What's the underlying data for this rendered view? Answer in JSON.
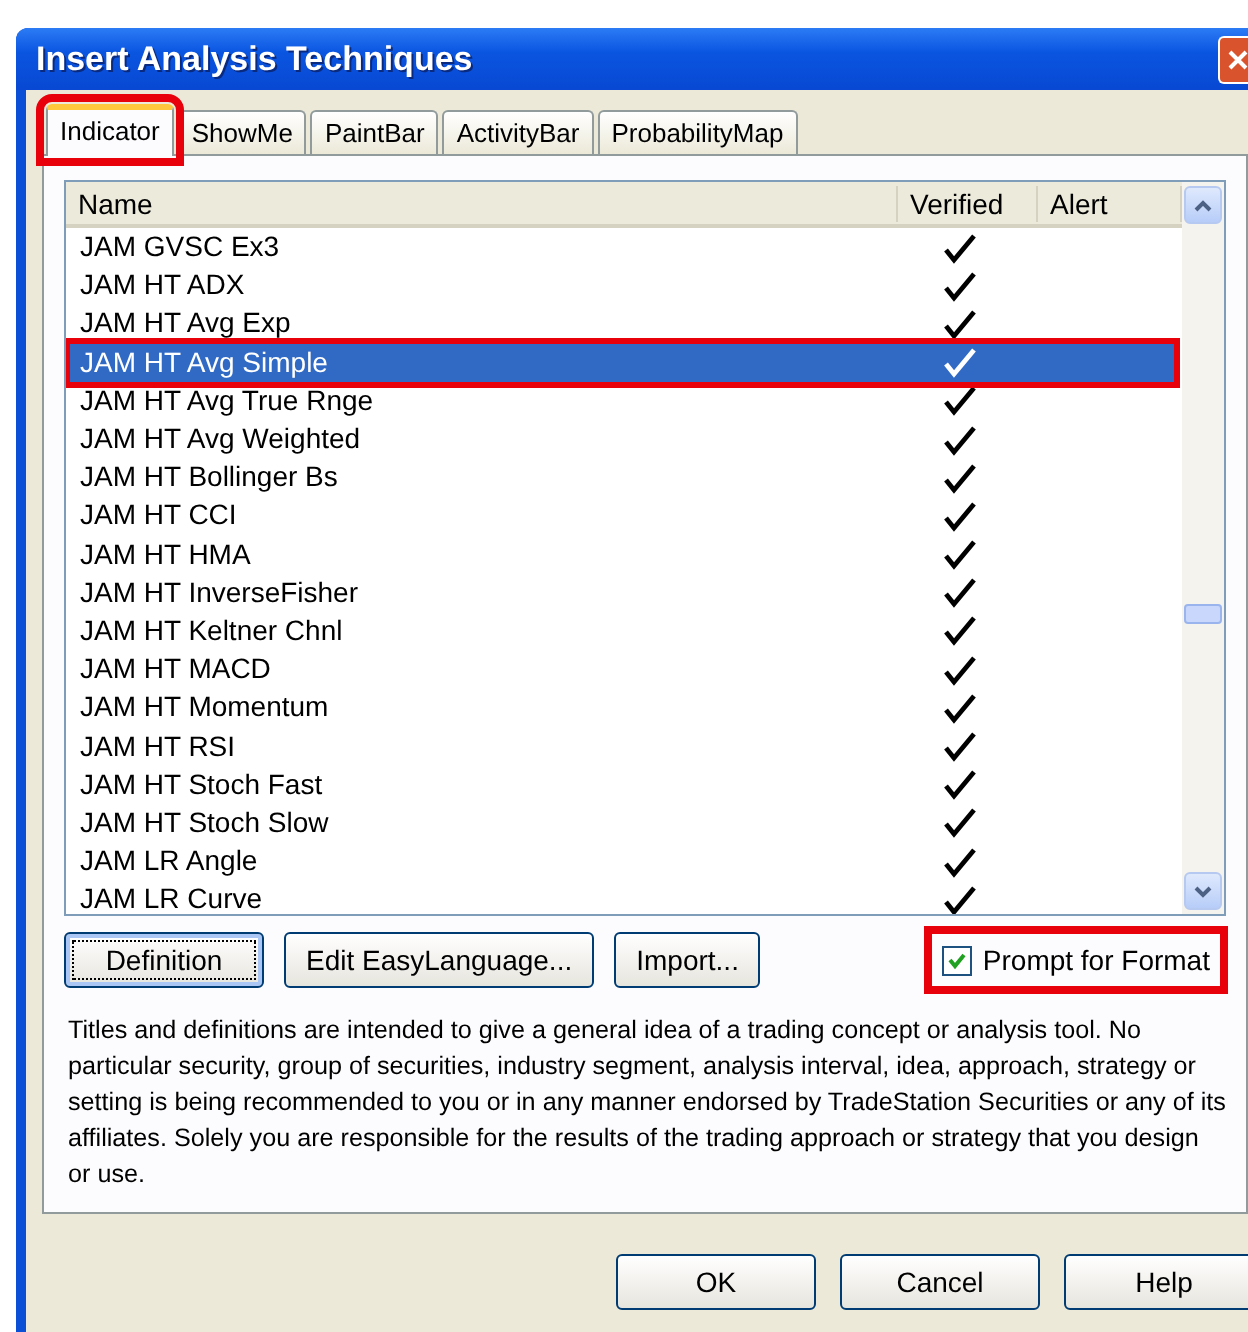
{
  "window": {
    "title": "Insert Analysis Techniques"
  },
  "tabs": [
    {
      "label": "Indicator",
      "selected": true,
      "highlighted": true
    },
    {
      "label": "ShowMe",
      "selected": false,
      "highlighted": false
    },
    {
      "label": "PaintBar",
      "selected": false,
      "highlighted": false
    },
    {
      "label": "ActivityBar",
      "selected": false,
      "highlighted": false
    },
    {
      "label": "ProbabilityMap",
      "selected": false,
      "highlighted": false
    }
  ],
  "list": {
    "columns": [
      "Name",
      "Verified",
      "Alert"
    ],
    "rows": [
      {
        "name": "JAM GVSC Ex3",
        "verified": true,
        "selected": false,
        "highlighted": false
      },
      {
        "name": "JAM HT ADX",
        "verified": true,
        "selected": false,
        "highlighted": false
      },
      {
        "name": "JAM HT Avg Exp",
        "verified": true,
        "selected": false,
        "highlighted": false
      },
      {
        "name": "JAM HT Avg Simple",
        "verified": true,
        "selected": true,
        "highlighted": true
      },
      {
        "name": "JAM HT Avg True Rnge",
        "verified": true,
        "selected": false,
        "highlighted": false
      },
      {
        "name": "JAM HT Avg Weighted",
        "verified": true,
        "selected": false,
        "highlighted": false
      },
      {
        "name": "JAM HT Bollinger Bs",
        "verified": true,
        "selected": false,
        "highlighted": false
      },
      {
        "name": "JAM HT CCI",
        "verified": true,
        "selected": false,
        "highlighted": false
      },
      {
        "name": "JAM HT HMA",
        "verified": true,
        "selected": false,
        "highlighted": false
      },
      {
        "name": "JAM HT InverseFisher",
        "verified": true,
        "selected": false,
        "highlighted": false
      },
      {
        "name": "JAM HT Keltner Chnl",
        "verified": true,
        "selected": false,
        "highlighted": false
      },
      {
        "name": "JAM HT MACD",
        "verified": true,
        "selected": false,
        "highlighted": false
      },
      {
        "name": "JAM HT Momentum",
        "verified": true,
        "selected": false,
        "highlighted": false
      },
      {
        "name": "JAM HT RSI",
        "verified": true,
        "selected": false,
        "highlighted": false
      },
      {
        "name": "JAM HT Stoch Fast",
        "verified": true,
        "selected": false,
        "highlighted": false
      },
      {
        "name": "JAM HT Stoch Slow",
        "verified": true,
        "selected": false,
        "highlighted": false
      },
      {
        "name": "JAM LR Angle",
        "verified": true,
        "selected": false,
        "highlighted": false
      },
      {
        "name": "JAM LR Curve",
        "verified": true,
        "selected": false,
        "highlighted": false
      }
    ]
  },
  "buttons": [
    "Definition",
    "Edit EasyLanguage...",
    "Import..."
  ],
  "prompt_checkbox": {
    "label": "Prompt for Format",
    "checked": true,
    "highlighted": true
  },
  "disclaimer": "Titles and definitions are intended to give a general idea of a trading concept or analysis tool. No particular security, group of securities, industry segment, analysis interval, idea, approach, strategy or setting is being recommended to you or in any manner endorsed by TradeStation Securities or any of its affiliates. Solely you are responsible for the results of the trading approach or strategy that you design or use.",
  "dialog_buttons": [
    "OK",
    "Cancel",
    "Help"
  ]
}
